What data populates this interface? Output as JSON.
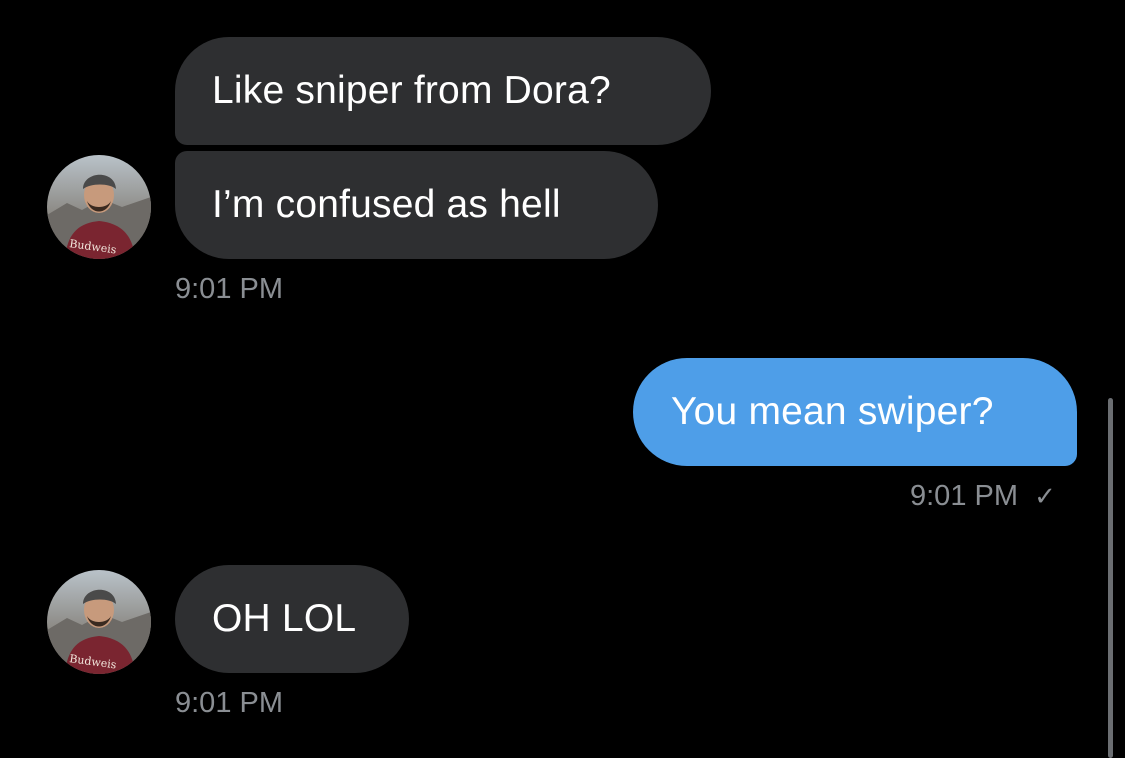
{
  "thread": {
    "group1": {
      "messages": [
        {
          "text": "Like sniper from Dora?"
        },
        {
          "text": "I’m confused as hell"
        }
      ],
      "timestamp": "9:01 PM",
      "avatar_icon": "person-beanie-avatar"
    },
    "outgoing": {
      "message": {
        "text": "You mean swiper?"
      },
      "timestamp": "9:01 PM",
      "read_receipt_icon": "checkmark-icon",
      "read_receipt_glyph": "✓"
    },
    "group2": {
      "messages": [
        {
          "text": "OH LOL"
        }
      ],
      "timestamp": "9:01 PM",
      "avatar_icon": "person-beanie-avatar"
    }
  },
  "colors": {
    "background": "#000000",
    "incoming_bubble": "#2e2f31",
    "outgoing_bubble": "#4e9ee8",
    "timestamp": "#8a8e93"
  }
}
